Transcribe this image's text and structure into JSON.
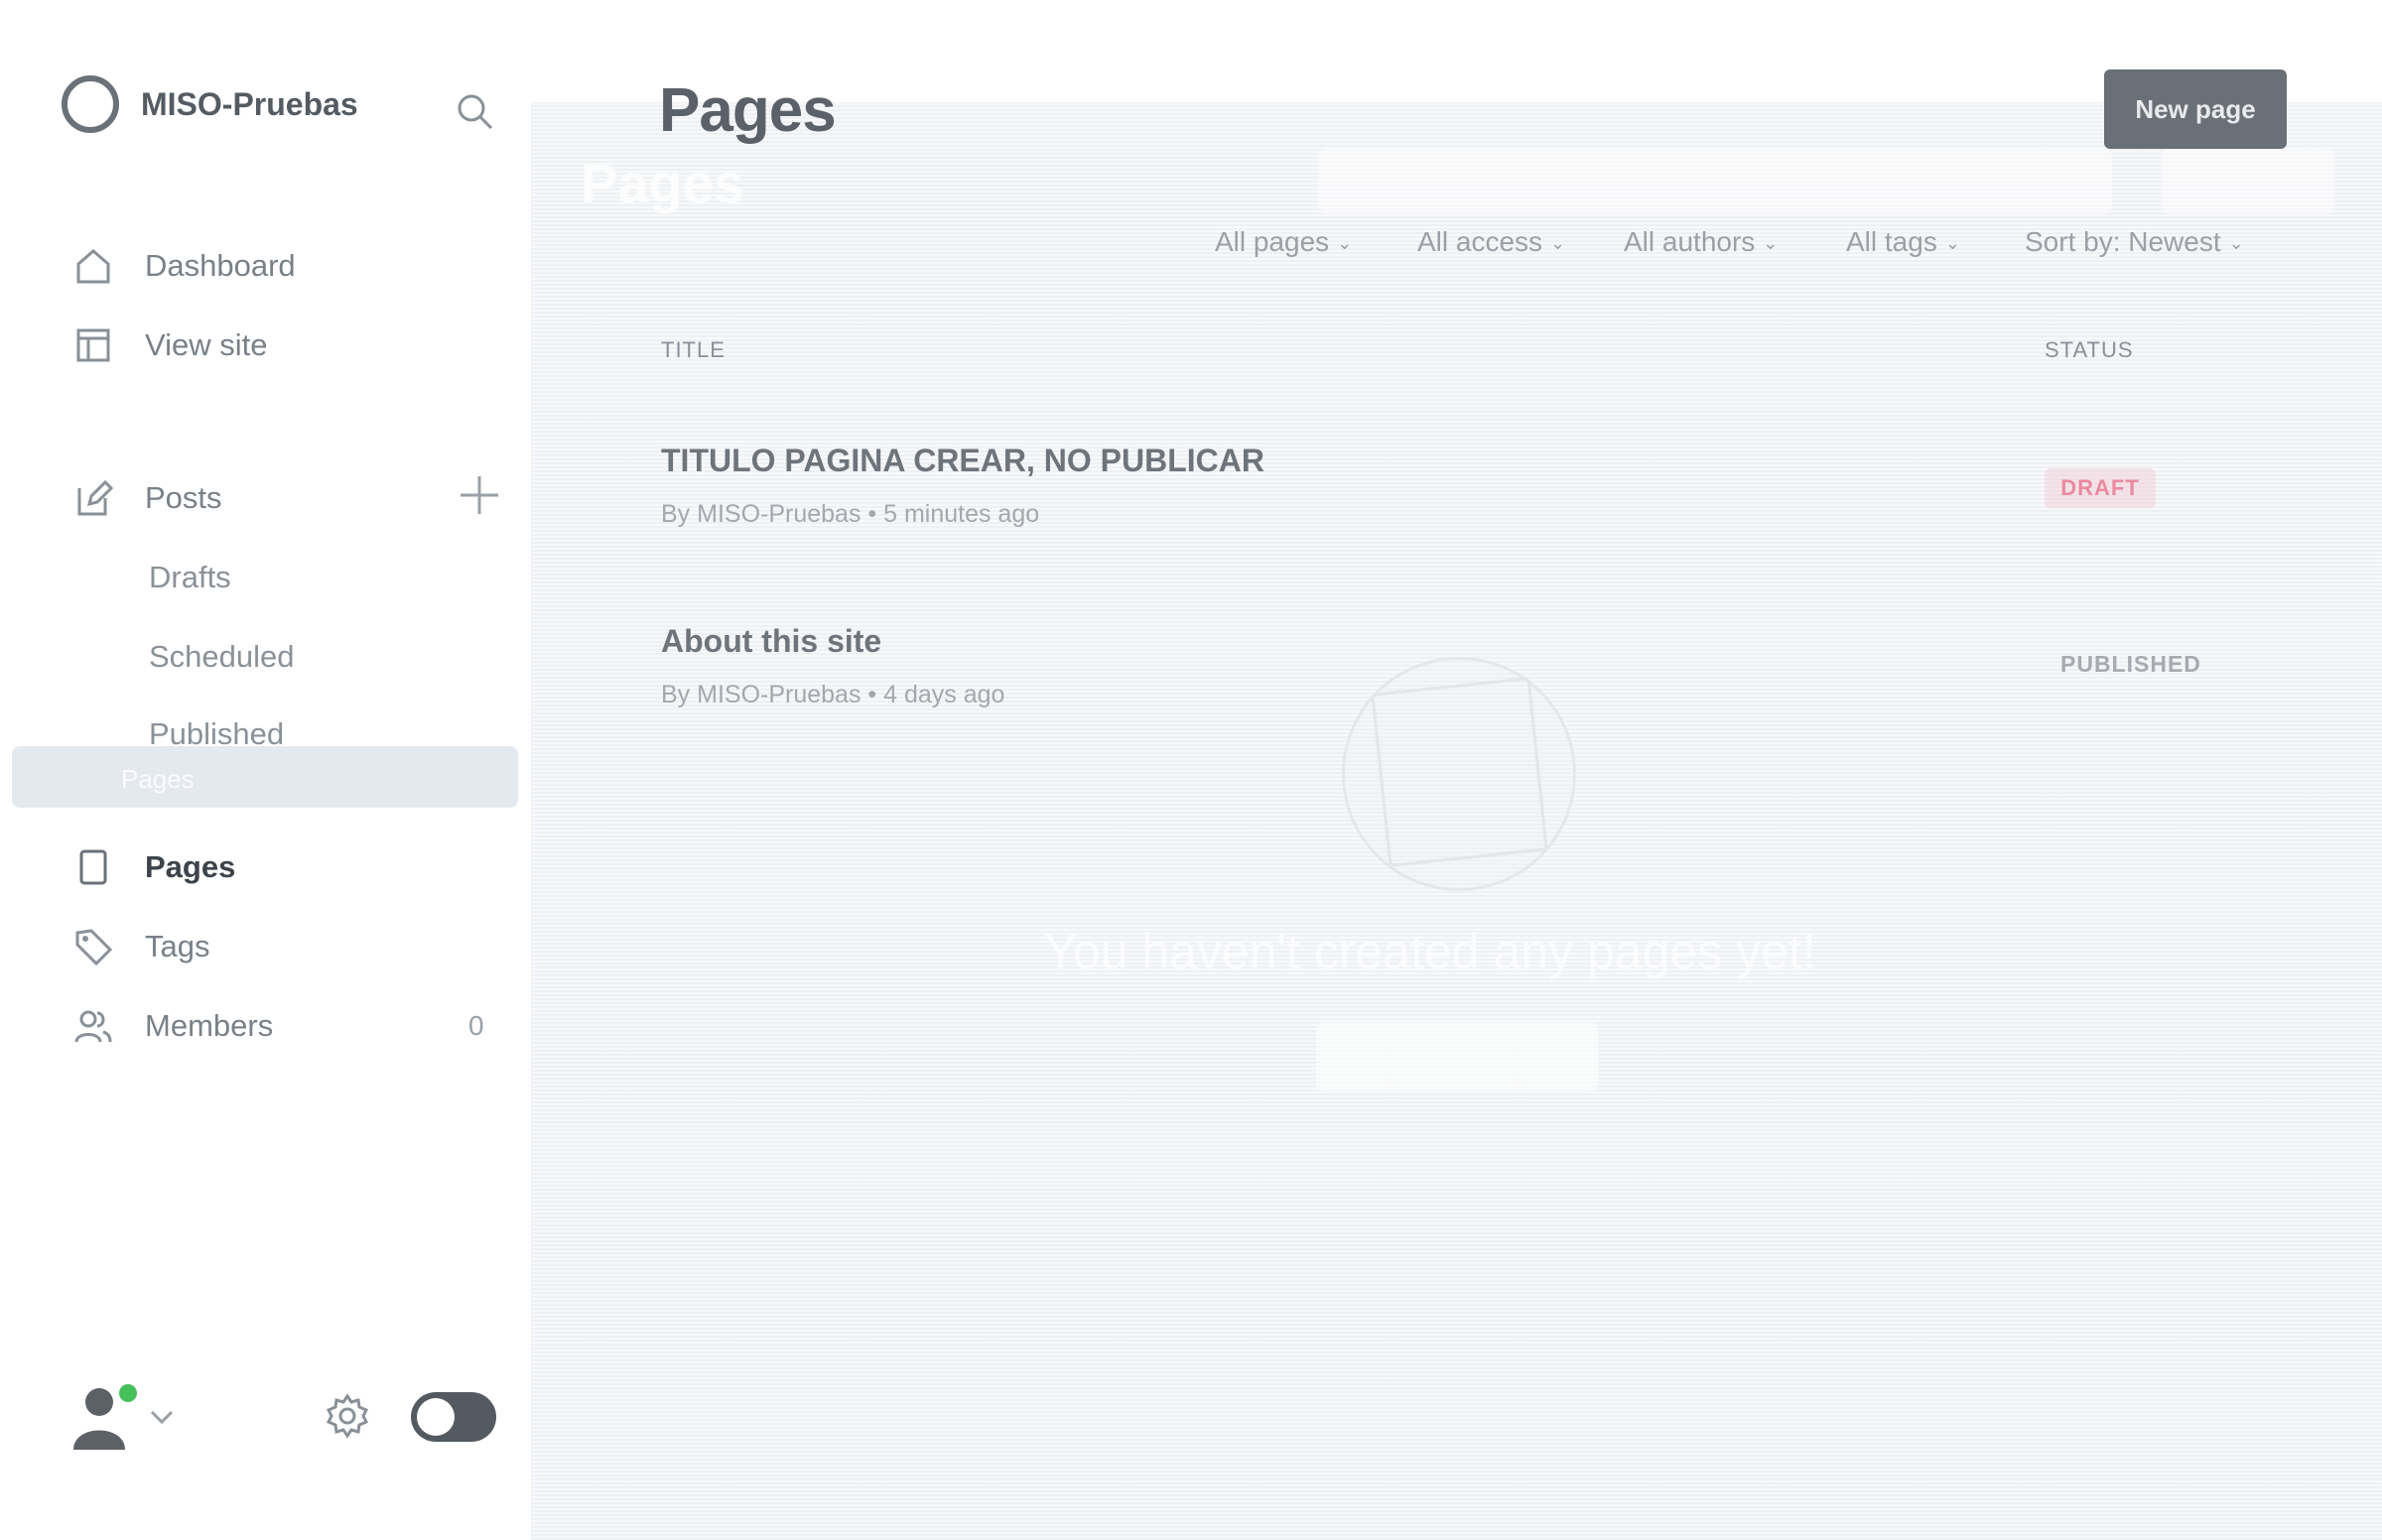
{
  "app": {
    "site_name": "MISO-Pruebas"
  },
  "sidebar": {
    "items": [
      {
        "label": "Dashboard",
        "icon": "home-icon"
      },
      {
        "label": "View site",
        "icon": "window-icon"
      },
      {
        "label": "Posts",
        "icon": "edit-icon"
      },
      {
        "label": "Pages",
        "icon": "page-icon"
      },
      {
        "label": "Tags",
        "icon": "tag-icon"
      },
      {
        "label": "Members",
        "icon": "members-icon"
      }
    ],
    "post_subitems": [
      "Drafts",
      "Scheduled",
      "Published"
    ],
    "members_count": "0"
  },
  "main": {
    "title": "Pages",
    "new_page_label": "New page",
    "filters": [
      "All pages",
      "All access",
      "All authors",
      "All tags",
      "Sort by: Newest"
    ],
    "columns": {
      "title": "TITLE",
      "status": "STATUS"
    },
    "rows": [
      {
        "title": "TITULO PAGINA CREAR, NO PUBLICAR",
        "meta": "By MISO-Pruebas • 5 minutes ago",
        "status": "DRAFT"
      },
      {
        "title": "About this site",
        "meta": "By MISO-Pruebas • 4 days ago",
        "status": "PUBLISHED"
      }
    ]
  },
  "ghost": {
    "title": "Pages",
    "selected_label": "Pages",
    "empty_text": "You haven't created any pages yet!"
  },
  "colors": {
    "draft": "#e98aa0",
    "online": "#46c05b",
    "button": "#6a7077"
  }
}
